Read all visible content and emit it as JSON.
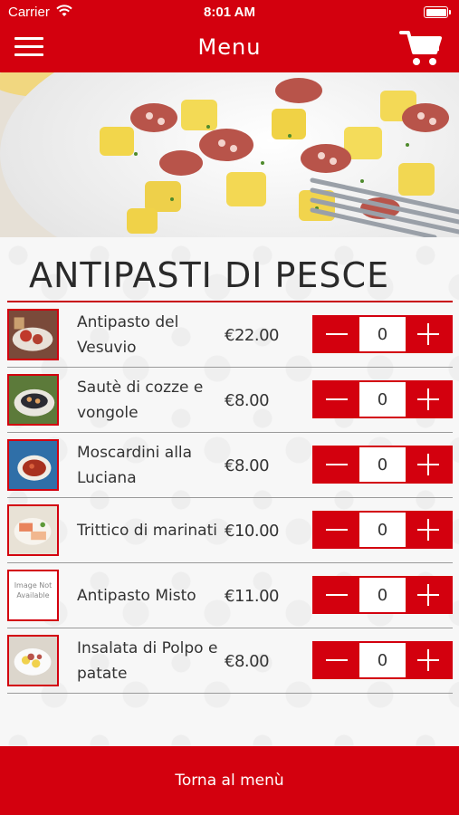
{
  "status_bar": {
    "carrier": "Carrier",
    "time": "8:01 AM"
  },
  "nav": {
    "title": "Menu",
    "menu_icon": "hamburger-icon",
    "cart_icon": "cart-icon"
  },
  "theme": {
    "accent": "#d3000e"
  },
  "section": {
    "title": "ANTIPASTI DI PESCE"
  },
  "items": [
    {
      "name": "Antipasto del Vesuvio",
      "price": "€22.00",
      "qty": "0"
    },
    {
      "name": "Sautè di cozze e vongole",
      "price": "€8.00",
      "qty": "0"
    },
    {
      "name": "Moscardini alla Luciana",
      "price": "€8.00",
      "qty": "0"
    },
    {
      "name": "Trittico di marinati",
      "price": "€10.00",
      "qty": "0"
    },
    {
      "name": "Antipasto Misto",
      "price": "€11.00",
      "qty": "0",
      "image_placeholder": "Image Not Available"
    },
    {
      "name": "Insalata di Polpo e patate",
      "price": "€8.00",
      "qty": "0"
    }
  ],
  "footer": {
    "back_label": "Torna al menù"
  }
}
